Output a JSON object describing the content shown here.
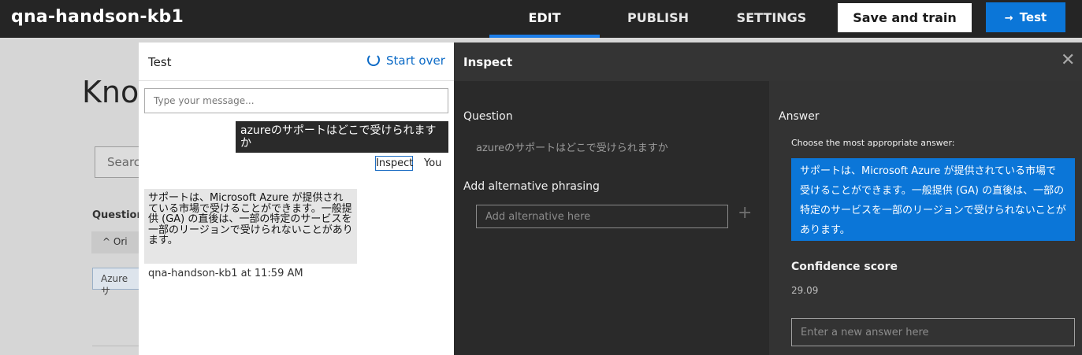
{
  "app": {
    "title": "qna-handson-kb1"
  },
  "nav": {
    "edit": "EDIT",
    "publish": "PUBLISH",
    "settings": "SETTINGS"
  },
  "actions": {
    "save_train": "Save and train",
    "test": "Test",
    "test_icon": "arrow-right-icon"
  },
  "background": {
    "title": "Know",
    "search_placeholder": "Search",
    "question_header": "Question",
    "orig_label": "Ori",
    "chip": "Azure サ"
  },
  "test_panel": {
    "title": "Test",
    "start_over": "Start over",
    "input_placeholder": "Type your message...",
    "user_message": "azureのサポートはどこで受けられますか",
    "inspect": "Inspect",
    "you": "You",
    "bot_message": "サポートは、Microsoft Azure が提供されている市場で受けることができます。一般提供 (GA) の直後は、一部の特定のサービスを一部のリージョンで受けられないことがあります。",
    "bot_meta": "qna-handson-kb1 at 11:59 AM"
  },
  "inspect_panel": {
    "title": "Inspect",
    "question_label": "Question",
    "question_text": "azureのサポートはどこで受けられますか",
    "alt_label": "Add alternative phrasing",
    "alt_placeholder": "Add alternative here",
    "answer_label": "Answer",
    "choose_text": "Choose the most appropriate answer:",
    "answer_text": "サポートは、Microsoft Azure が提供されている市場で受けることができます。一般提供 (GA) の直後は、一部の特定のサービスを一部のリージョンで受けられないことがあります。",
    "confidence_label": "Confidence score",
    "confidence_value": "29.09",
    "new_answer_placeholder": "Enter a new answer here"
  },
  "colors": {
    "accent": "#0b76d8",
    "topbar": "#252525",
    "panel_dark": "#2b2b2b"
  }
}
